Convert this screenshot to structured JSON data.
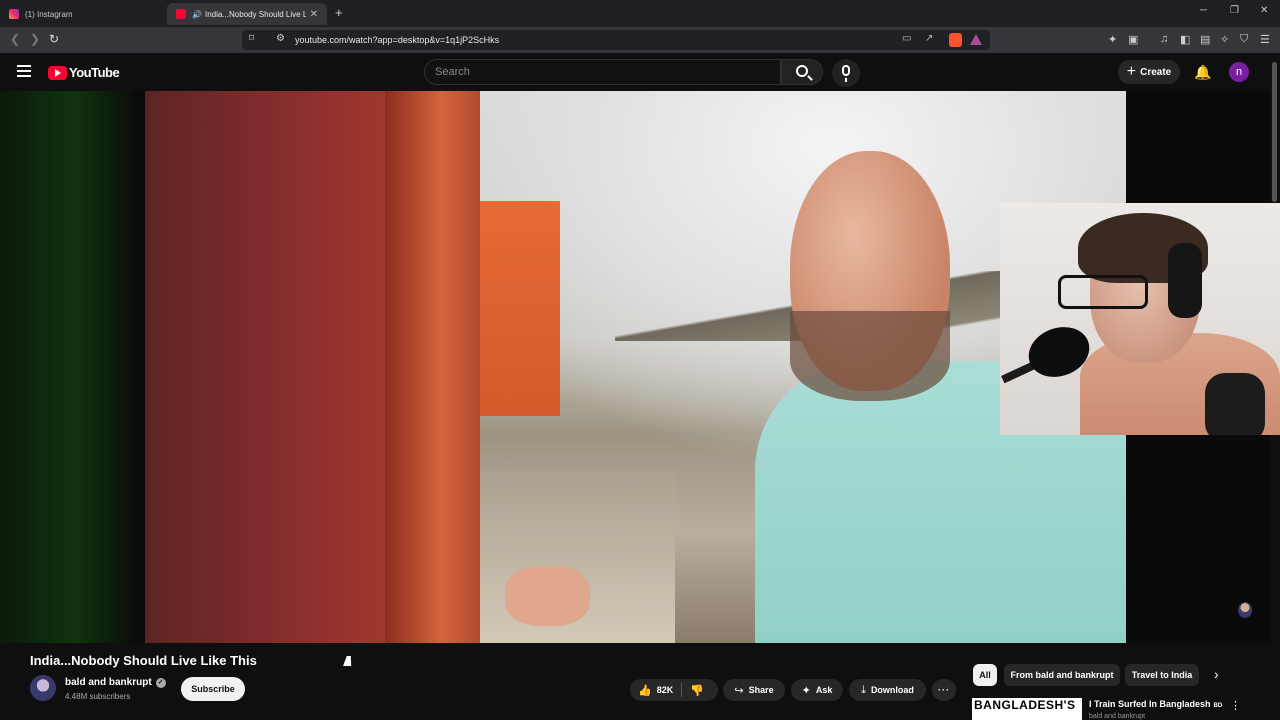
{
  "browser": {
    "tabs": [
      {
        "label": "(1) Instagram",
        "active": false
      },
      {
        "label": "India...Nobody Should Live Li",
        "active": true
      }
    ],
    "url": "youtube.com/watch?app=desktop&v=1q1jP2ScHks"
  },
  "youtube": {
    "logo_text": "YouTube",
    "search_placeholder": "Search",
    "create_label": "Create",
    "avatar_letter": "n"
  },
  "video": {
    "title": "India...Nobody Should Live Like This",
    "channel": "bald and bankrupt",
    "subscribers": "4.48M subscribers",
    "subscribe_label": "Subscribe",
    "likes": "82K",
    "share_label": "Share",
    "ask_label": "Ask",
    "download_label": "Download"
  },
  "chips": [
    "All",
    "From bald and bankrupt",
    "Travel to India"
  ],
  "recommendation": {
    "thumb_text": "BANGLADESH'S",
    "title": "I Train Surfed In Bangladesh",
    "tag": "BD",
    "meta": "bald and bankrupt"
  },
  "colors": {
    "accent": "#ff0033",
    "avatar": "#7b1fa2"
  }
}
